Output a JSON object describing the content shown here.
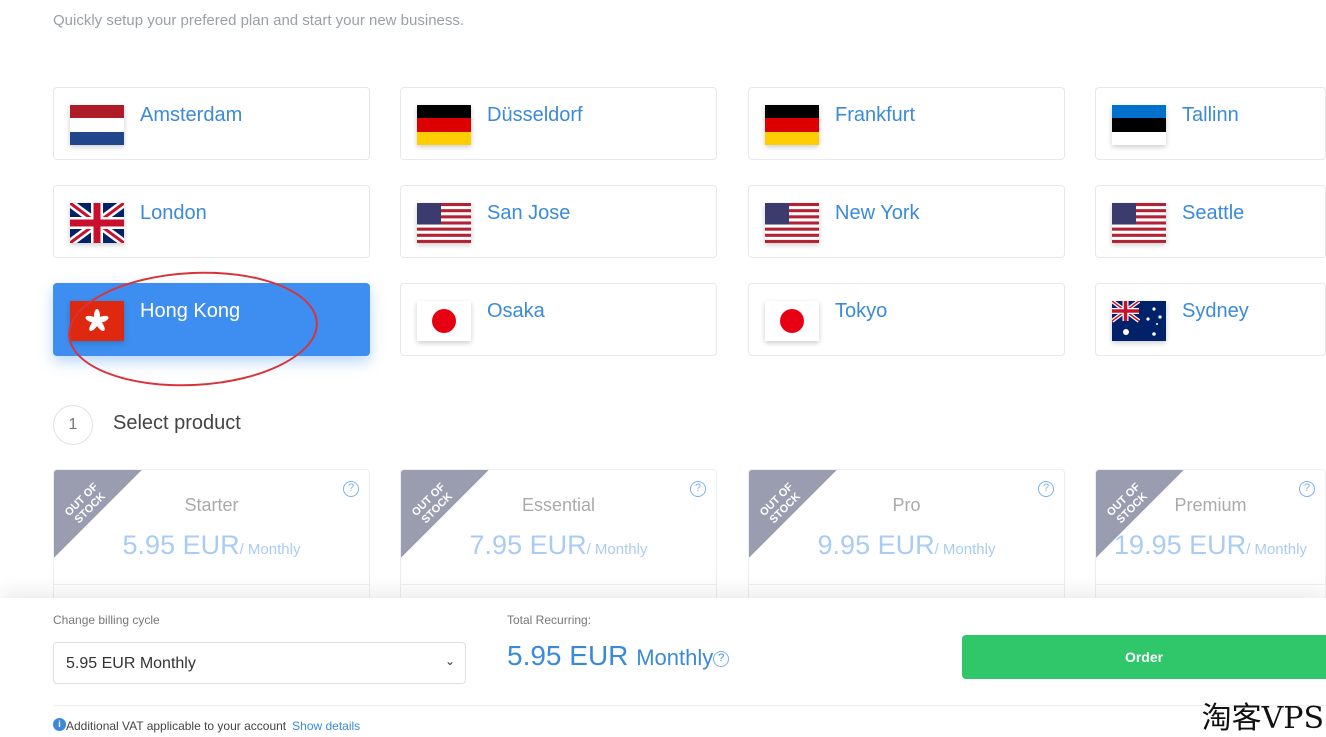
{
  "subtitle": "Quickly setup your prefered plan and start your new business.",
  "locations": [
    {
      "name": "Amsterdam",
      "flag": "nl",
      "selected": false
    },
    {
      "name": "Düsseldorf",
      "flag": "de",
      "selected": false
    },
    {
      "name": "Frankfurt",
      "flag": "de",
      "selected": false
    },
    {
      "name": "Tallinn",
      "flag": "ee",
      "selected": false
    },
    {
      "name": "London",
      "flag": "gb",
      "selected": false
    },
    {
      "name": "San Jose",
      "flag": "us",
      "selected": false
    },
    {
      "name": "New York",
      "flag": "us",
      "selected": false
    },
    {
      "name": "Seattle",
      "flag": "us",
      "selected": false
    },
    {
      "name": "Hong Kong",
      "flag": "hk",
      "selected": true
    },
    {
      "name": "Osaka",
      "flag": "jp",
      "selected": false
    },
    {
      "name": "Tokyo",
      "flag": "jp",
      "selected": false
    },
    {
      "name": "Sydney",
      "flag": "au",
      "selected": false
    }
  ],
  "step": {
    "number": "1",
    "title": "Select product"
  },
  "products": [
    {
      "ribbon": "OUT OF STOCK",
      "name": "Starter",
      "price": "5.95 EUR",
      "period": "/ Monthly"
    },
    {
      "ribbon": "OUT OF STOCK",
      "name": "Essential",
      "price": "7.95 EUR",
      "period": "/ Monthly"
    },
    {
      "ribbon": "OUT OF STOCK",
      "name": "Pro",
      "price": "9.95 EUR",
      "period": "/ Monthly"
    },
    {
      "ribbon": "OUT OF STOCK",
      "name": "Premium",
      "price": "19.95 EUR",
      "period": "/ Monthly"
    }
  ],
  "billing": {
    "label": "Change billing cycle",
    "selected": "5.95 EUR Monthly",
    "total_label": "Total Recurring:",
    "total_price": "5.95 EUR",
    "total_period": "Monthly",
    "order": "Order",
    "vat_text": "Additional VAT applicable to your account",
    "vat_link": "Show details"
  },
  "watermark": "淘客VPS",
  "colors": {
    "accent": "#3d8ef0",
    "order": "#2fc76a",
    "ribbon": "#9a9cb0"
  }
}
